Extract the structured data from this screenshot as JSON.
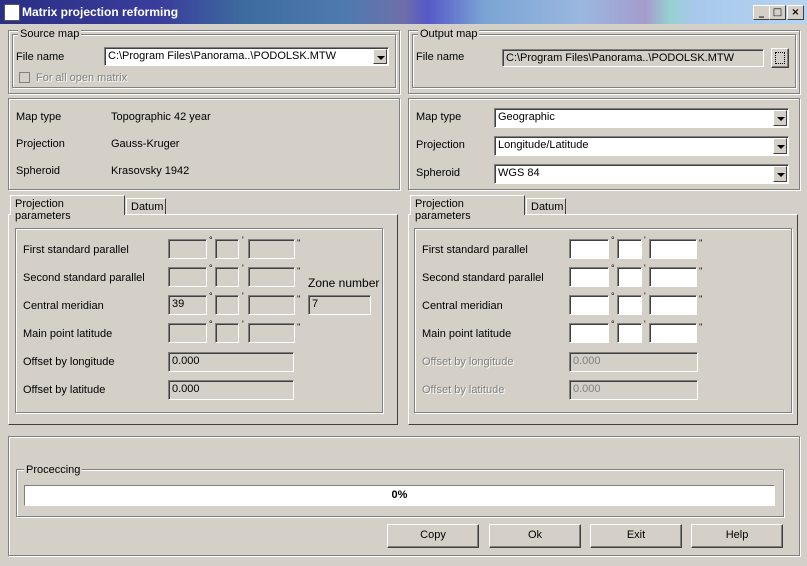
{
  "window": {
    "title": "Matrix projection reforming",
    "minimize": "_",
    "maximize": "□",
    "close": "×"
  },
  "source": {
    "legend": "Source map",
    "file_label": "File name",
    "file_value": "C:\\Program Files\\Panorama..\\PODOLSK.MTW",
    "all_open_label": "For all open matrix",
    "map_type_label": "Map type",
    "map_type_value": "Topographic 42 year",
    "projection_label": "Projection",
    "projection_value": "Gauss-Kruger",
    "spheroid_label": "Spheroid",
    "spheroid_value": "Krasovsky 1942",
    "tabs": [
      "Projection parameters",
      "Datum"
    ],
    "params": {
      "first_parallel": "First standard parallel",
      "second_parallel": "Second standard parallel",
      "central_meridian": "Central meridian",
      "central_meridian_deg": "39",
      "main_point_lat": "Main point latitude",
      "offset_lon": "Offset by longitude",
      "offset_lon_value": "0.000",
      "offset_lat": "Offset by latitude",
      "offset_lat_value": "0.000",
      "zone_label": "Zone number",
      "zone_value": "7"
    }
  },
  "output": {
    "legend": "Output map",
    "file_label": "File name",
    "file_value": "C:\\Program Files\\Panorama..\\PODOLSK.MTW",
    "map_type_label": "Map type",
    "map_type_value": "Geographic",
    "projection_label": "Projection",
    "projection_value": "Longitude/Latitude",
    "spheroid_label": "Spheroid",
    "spheroid_value": "WGS 84",
    "tabs": [
      "Projection parameters",
      "Datum"
    ],
    "params": {
      "first_parallel": "First standard parallel",
      "second_parallel": "Second standard parallel",
      "central_meridian": "Central meridian",
      "main_point_lat": "Main point latitude",
      "offset_lon": "Offset by longitude",
      "offset_lon_value": "0.000",
      "offset_lat": "Offset by latitude",
      "offset_lat_value": "0.000"
    }
  },
  "processing": {
    "legend": "Proceccing",
    "progress_text": "0%",
    "progress": 0
  },
  "buttons": {
    "copy": "Copy",
    "ok": "Ok",
    "exit": "Exit",
    "help": "Help"
  },
  "symbols": {
    "deg": "°",
    "min": "'",
    "sec": "''"
  }
}
